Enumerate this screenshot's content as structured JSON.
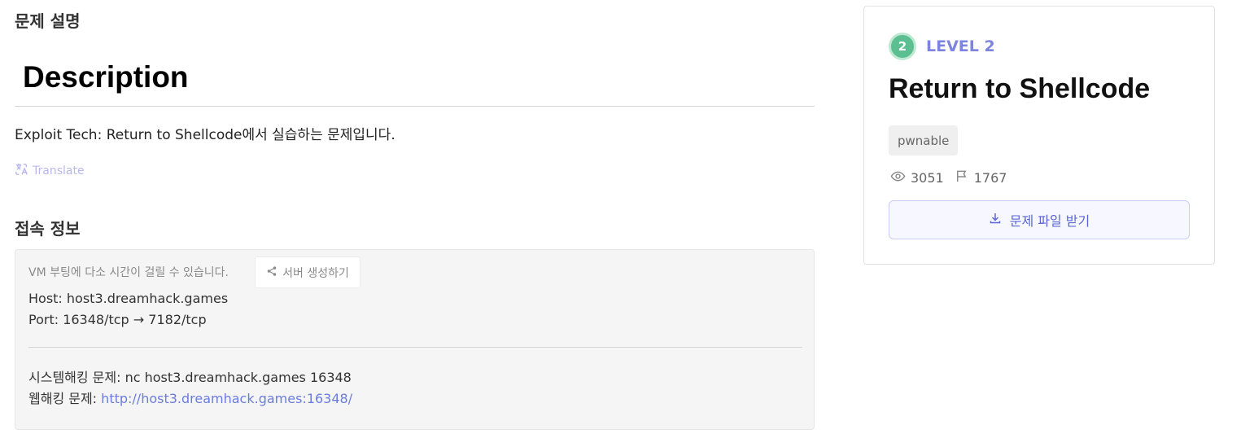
{
  "left": {
    "problem_heading": "문제 설명",
    "description_heading": "Description",
    "description_text": "Exploit Tech: Return to Shellcode에서 실습하는 문제입니다.",
    "translate_label": "Translate",
    "access_heading": "접속 정보",
    "access": {
      "boot_note": "VM 부팅에 다소 시간이 걸릴 수 있습니다.",
      "server_button": "서버 생성하기",
      "host": "Host: host3.dreamhack.games",
      "port": "Port:  16348/tcp → 7182/tcp",
      "system_hacking": "시스템해킹 문제: nc host3.dreamhack.games 16348",
      "web_hacking_label": "웹해킹 문제: ",
      "web_hacking_url": "http://host3.dreamhack.games:16348/"
    }
  },
  "card": {
    "level_number": "2",
    "level_label": "LEVEL 2",
    "title": "Return to Shellcode",
    "tag": "pwnable",
    "views": "3051",
    "solves": "1767",
    "download_label": "문제 파일 받기"
  },
  "colors": {
    "accent": "#7d84e0",
    "level_badge": "#5bbf91",
    "link": "#6b7cde",
    "box_bg": "#f5f5f5"
  },
  "icons": {
    "translate": "translate-icon",
    "share": "share-icon",
    "views": "eye-icon",
    "solves": "flag-icon",
    "download": "download-icon"
  }
}
